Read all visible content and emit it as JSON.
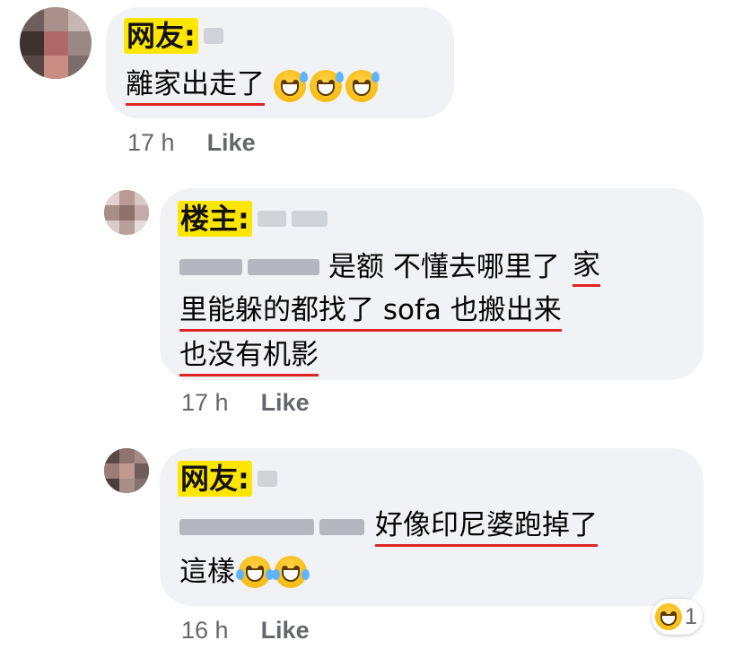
{
  "comments": [
    {
      "tag": "网友:",
      "text_lines": [
        "離家出走了"
      ],
      "emoji": [
        "grinning-sweat",
        "grinning-sweat",
        "grinning-sweat"
      ],
      "time": "17 h",
      "like": "Like"
    },
    {
      "tag": "楼主:",
      "text_lines": [
        "是额  不懂去哪里了",
        "家",
        "里能躲的都找了 sofa 也搬出来",
        "也没有机影"
      ],
      "time": "17 h",
      "like": "Like"
    },
    {
      "tag": "网友:",
      "text_lines": [
        "好像印尼婆跑掉了",
        "這樣"
      ],
      "emoji": [
        "tears-of-joy",
        "tears-of-joy"
      ],
      "time": "16 h",
      "like": "Like",
      "reaction": {
        "icon": "laughing-face",
        "count": "1"
      }
    }
  ],
  "colors": {
    "bubble": "#f0f2f5",
    "tag_highlight": "#ffe600",
    "underline": "#e02424",
    "meta": "#65676b"
  }
}
